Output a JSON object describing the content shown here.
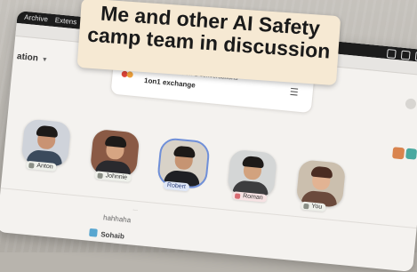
{
  "caption": {
    "line1": "Me and other AI Safety",
    "line2": "camp team in discussion"
  },
  "menubar": {
    "items": [
      "Archive",
      "Extens"
    ]
  },
  "app": {
    "title_partial": "ation"
  },
  "next_game": {
    "label": "Next Game: 1-on-1 conversations",
    "name": "1on1 exchange"
  },
  "participants": [
    {
      "name": "Anton",
      "muted": true
    },
    {
      "name": "Johnnie",
      "muted": true
    },
    {
      "name": "Robert",
      "muted": false,
      "speaking": true
    },
    {
      "name": "Roman",
      "muted": true
    },
    {
      "name": "You",
      "muted": true
    }
  ],
  "chat": {
    "faint": "...",
    "message": "hahhaha",
    "sender": "Sohaib"
  },
  "colors": {
    "accent_blue": "#2b3f7a",
    "caption_bg": "#f6e9d3",
    "muted_red": "#d86b72"
  }
}
